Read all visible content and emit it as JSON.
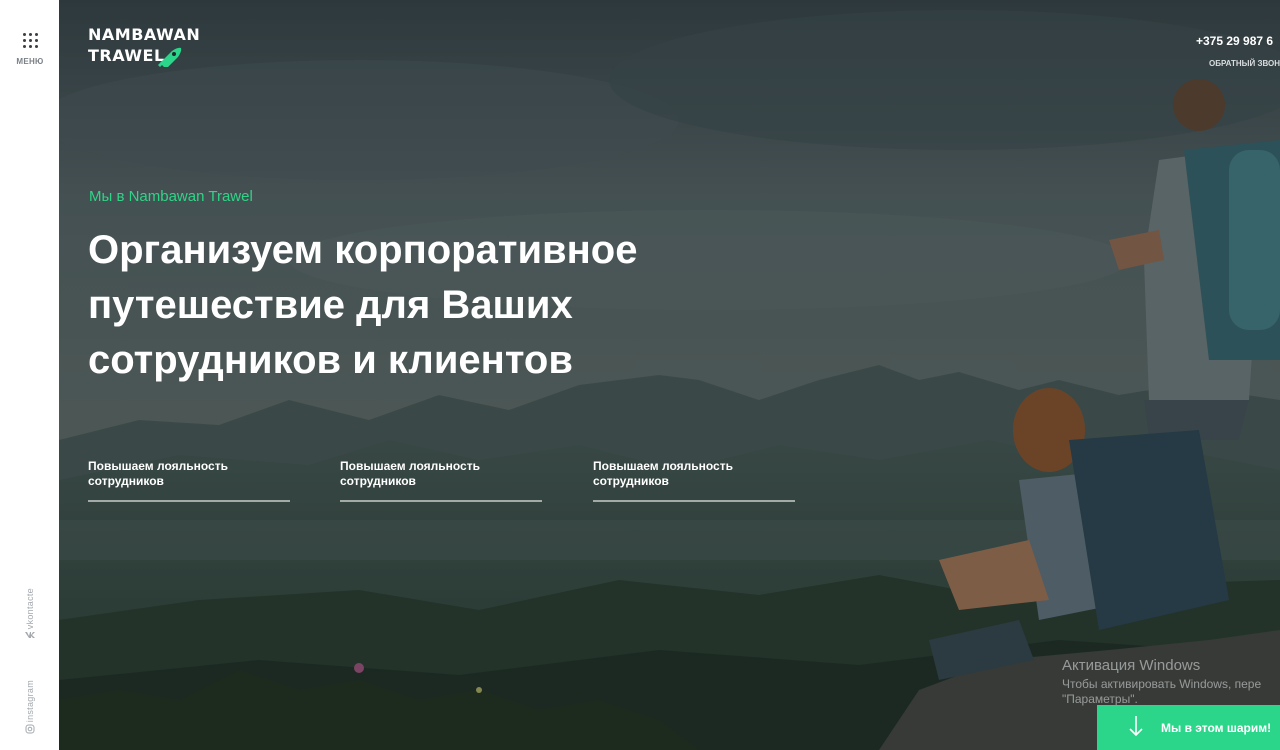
{
  "sidebar": {
    "menu_label": "МЕНЮ",
    "social": [
      {
        "label": "vkontacte",
        "icon": "vk-icon"
      },
      {
        "label": "instagram",
        "icon": "instagram-icon"
      }
    ]
  },
  "header": {
    "logo": {
      "line1": "NAMBAWAN",
      "line2": "TRAWEL",
      "icon": "rocket-icon"
    },
    "phone": "+375 29 987 6",
    "callback": "ОБРАТНЫЙ ЗВОН"
  },
  "hero": {
    "tagline": "Мы в Nambawan Trawel",
    "headline_lines": [
      "Организуем корпоративное",
      "путешествие для Ваших",
      "сотрудников и клиентов"
    ],
    "features": [
      {
        "line1": "Повышаем лояльность",
        "line2": "сотрудников"
      },
      {
        "line1": "Повышаем лояльность",
        "line2": "сотрудников"
      },
      {
        "line1": "Повышаем лояльность",
        "line2": "сотрудников"
      }
    ]
  },
  "watermark": {
    "title": "Активация Windows",
    "line2": "Чтобы активировать Windows, пере",
    "line3": "\"Параметры\"."
  },
  "cta": {
    "label": "Мы в этом шарим!",
    "icon": "arrow-down-icon"
  },
  "colors": {
    "accent": "#2bd68b",
    "tagline": "#2fd487",
    "sidebar_bg": "#ffffff"
  }
}
